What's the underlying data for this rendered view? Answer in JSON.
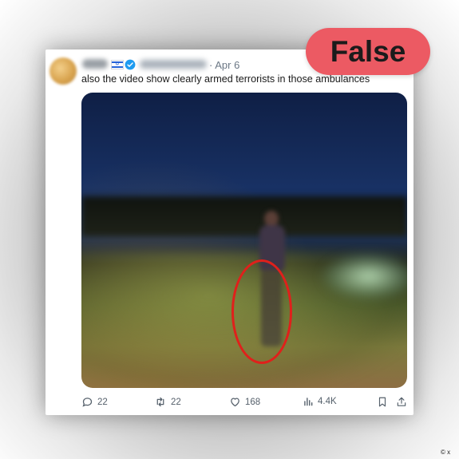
{
  "tweet": {
    "date_separator": "·",
    "date": "Apr 6",
    "text": "also the video show clearly armed terrorists in those ambulances"
  },
  "actions": {
    "replies": "22",
    "reposts": "22",
    "likes": "168",
    "views": "4.4K"
  },
  "badge": {
    "label": "False",
    "color": "#ec5a63"
  },
  "footer": {
    "copyright": "© x"
  },
  "colors": {
    "verified": "#1d9bf0",
    "highlight": "#e0201b",
    "muted_text": "#6b7785"
  }
}
